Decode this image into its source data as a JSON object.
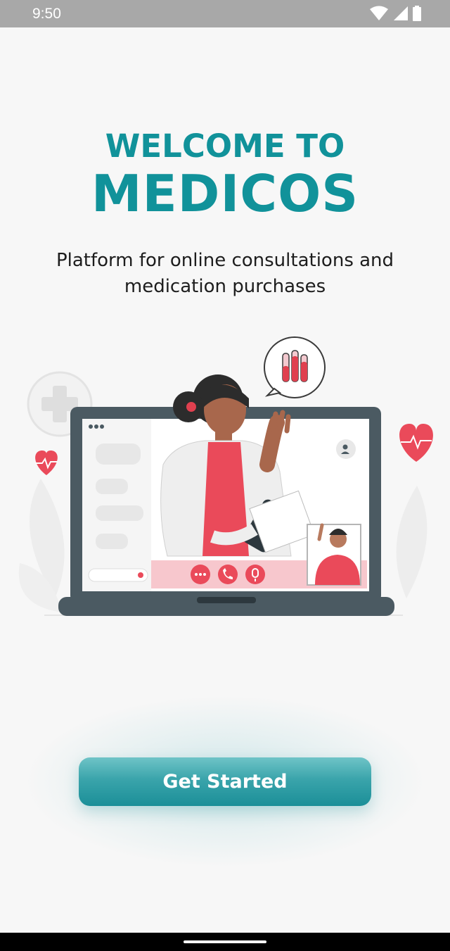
{
  "status_bar": {
    "time": "9:50"
  },
  "welcome": {
    "line1": "WELCOME TO",
    "line2": "MEDICOS",
    "subtitle": "Platform for online consultations and medication purchases"
  },
  "cta": {
    "label": "Get Started"
  },
  "colors": {
    "brand": "#11929a",
    "accent_red": "#ea4a5a",
    "laptop": "#4b5a62"
  },
  "icons": [
    "wifi-icon",
    "cellular-signal-icon",
    "battery-icon",
    "heart-icon",
    "plus-icon",
    "chart-bubble-icon",
    "phone-icon",
    "microphone-icon",
    "more-icon",
    "add-contact-icon"
  ]
}
